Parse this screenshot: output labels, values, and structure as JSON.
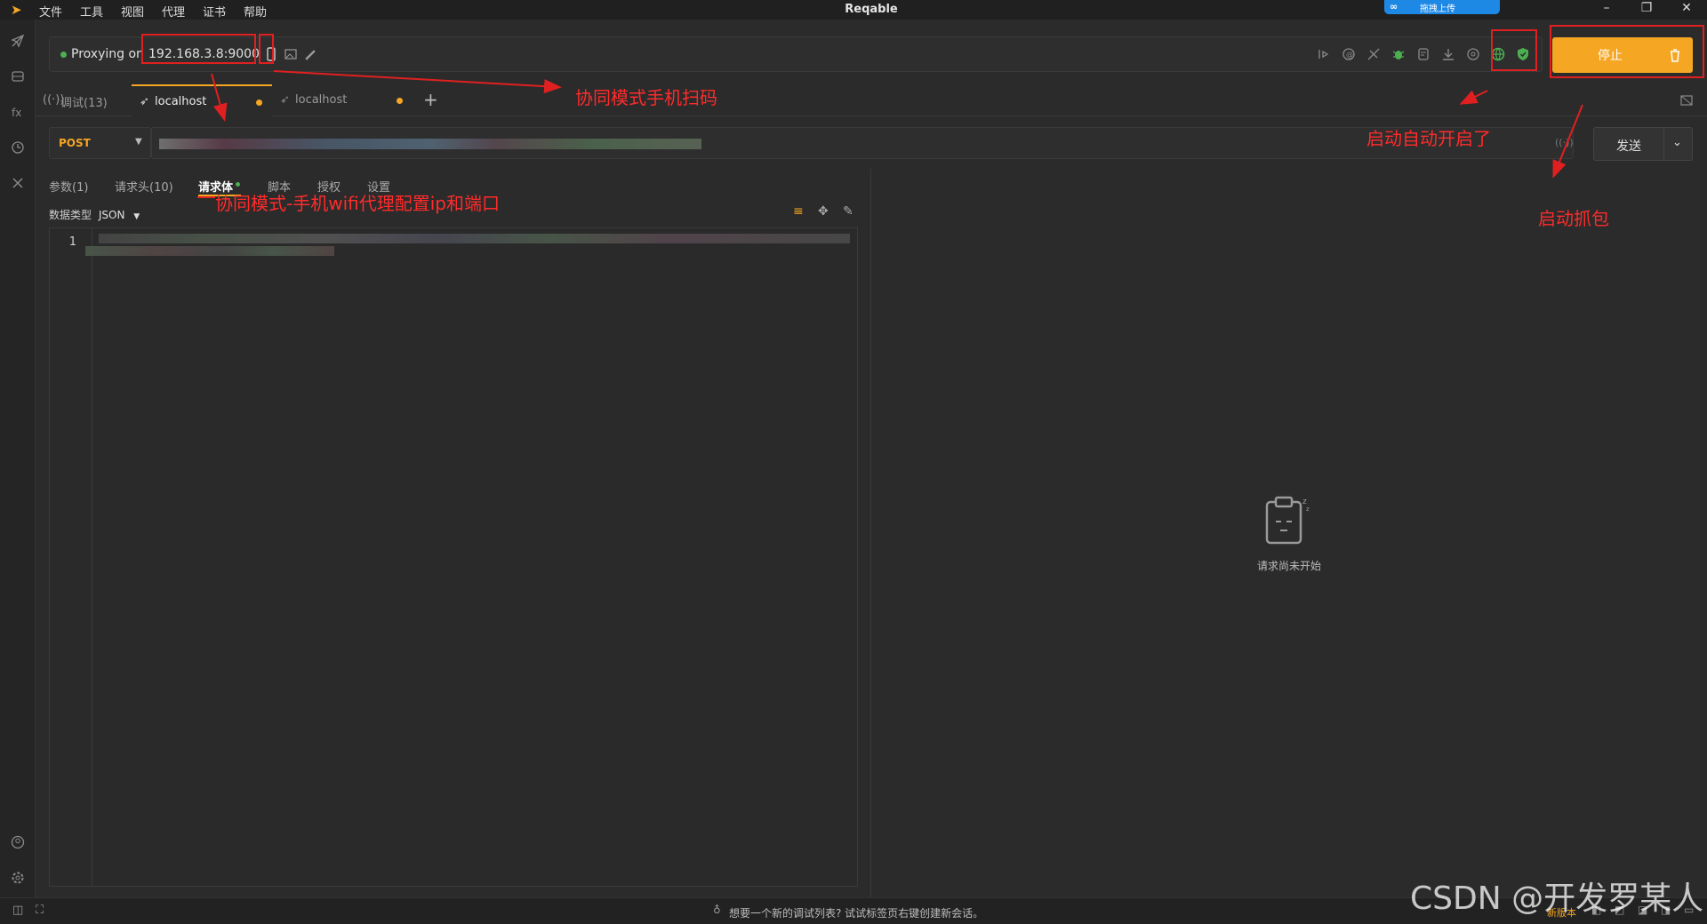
{
  "titlebar": {
    "app_title": "Reqable",
    "menu": [
      "文件",
      "工具",
      "视图",
      "代理",
      "证书",
      "帮助"
    ],
    "upload_badge": "拖拽上传"
  },
  "proxy": {
    "status_text": "Proxying on",
    "address": "192.168.3.8:9000",
    "stop_label": "停止"
  },
  "tabs": [
    {
      "label": "调试(13)"
    },
    {
      "label": "localhost"
    },
    {
      "label": "localhost"
    }
  ],
  "request": {
    "method": "POST",
    "send_label": "发送"
  },
  "subtabs": [
    "参数(1)",
    "请求头(10)",
    "请求体",
    "脚本",
    "授权",
    "设置"
  ],
  "body": {
    "datatype_label": "数据类型",
    "datatype_value": "JSON",
    "line_number": "1"
  },
  "response": {
    "empty_text": "请求尚未开始"
  },
  "statusbar": {
    "hint": "想要一个新的调试列表? 试试标签页右键创建新会话。",
    "new_version": "新版本"
  },
  "annotations": {
    "scan": "协同模式手机扫码",
    "auto_start": "启动自动开启了",
    "wifi_proxy": "协同模式-手机wifi代理配置ip和端口",
    "capture": "启动抓包"
  },
  "watermark": "CSDN @开发罗某人",
  "colors": {
    "accent": "#f5a623",
    "annotation": "#e02020",
    "proxy_status": "#4caf50"
  }
}
